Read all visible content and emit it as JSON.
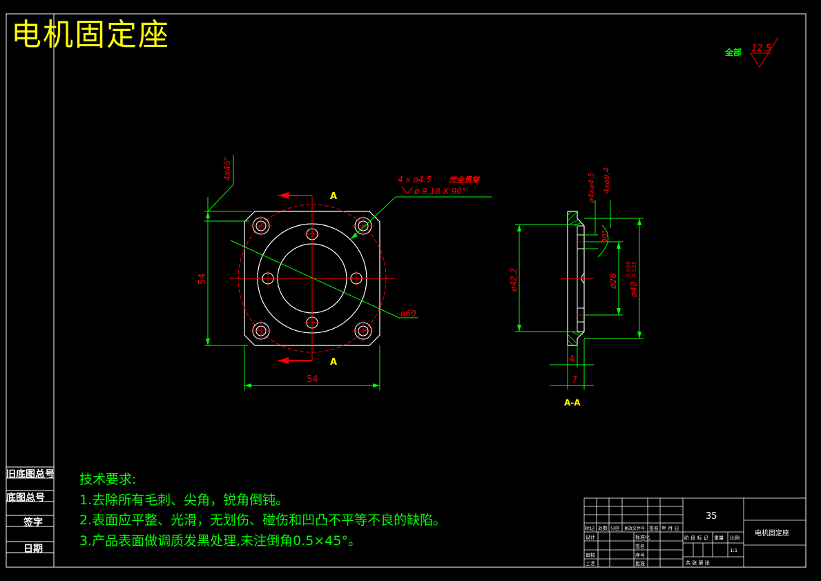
{
  "drawing_title": "电机固定座",
  "roughness": {
    "label": "全部",
    "value": "12.5"
  },
  "side_labels": [
    "旧底图总号",
    "底图总号",
    "签字",
    "日期"
  ],
  "tech_requirements": {
    "heading": "技术要求:",
    "items": [
      "1.去除所有毛刺、尖角，锐角倒钝。",
      "2.表面应平整、光滑，无划伤、碰伤和凹凸不平等不良的缺陷。",
      "3.产品表面做调质发黑处理,未注倒角0.5×45°。"
    ]
  },
  "dims_front": {
    "chamfer": "4x45°",
    "hole_note_1": "4 x ø4.5",
    "hole_note_1b": "完全贯穿",
    "hole_note_2": "ø 9.18 X 90°",
    "height": "54",
    "width": "54",
    "circle": "ø60",
    "section_mark": "A"
  },
  "dims_side": {
    "d1": "ø4xø4.5",
    "d2": "4xø9.4",
    "angle": "90°",
    "d3": "ø42.2",
    "d4": "ø28",
    "d5": "ø48",
    "d5_tol_upper": "-0.009",
    "d5_tol_lower": "-0.025",
    "w1": "4",
    "w2": "7",
    "section_label": "A-A"
  },
  "title_block": {
    "part_no": "35",
    "part_name": "电机固定座",
    "h_mark": "标记",
    "h_count": "处数",
    "h_zone": "分区",
    "h_change": "更改文件号",
    "h_sign": "签名",
    "h_date": "年 月 日",
    "r_design": "设计",
    "r_std": "标准化",
    "r_check": "审核",
    "r_proc": "工艺",
    "r_sign2": "签名",
    "r_no": "序号",
    "r_approve": "批准",
    "stage": "阶 段 标 记",
    "weight": "重量",
    "scale": "比例",
    "scale_val": "1:1",
    "sheets": "共   张   第   张"
  }
}
